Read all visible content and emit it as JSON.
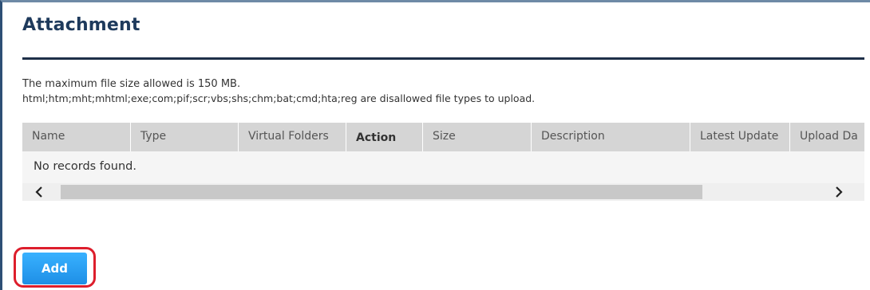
{
  "section": {
    "title": "Attachment",
    "max_size_note": "The maximum file size allowed is 150 MB.",
    "disallowed_note": "html;htm;mht;mhtml;exe;com;pif;scr;vbs;shs;chm;bat;cmd;hta;reg are disallowed file types to upload."
  },
  "table": {
    "columns": [
      "Name",
      "Type",
      "Virtual Folders",
      "Action",
      "Size",
      "Description",
      "Latest Update",
      "Upload Da"
    ],
    "empty_message": "No records found."
  },
  "scrollbar": {
    "left_icon": "chevron-left-icon",
    "right_icon": "chevron-right-icon"
  },
  "actions": {
    "add_label": "Add",
    "highlight_color": "#dd1e2c",
    "button_color": "#2a9ef2"
  }
}
